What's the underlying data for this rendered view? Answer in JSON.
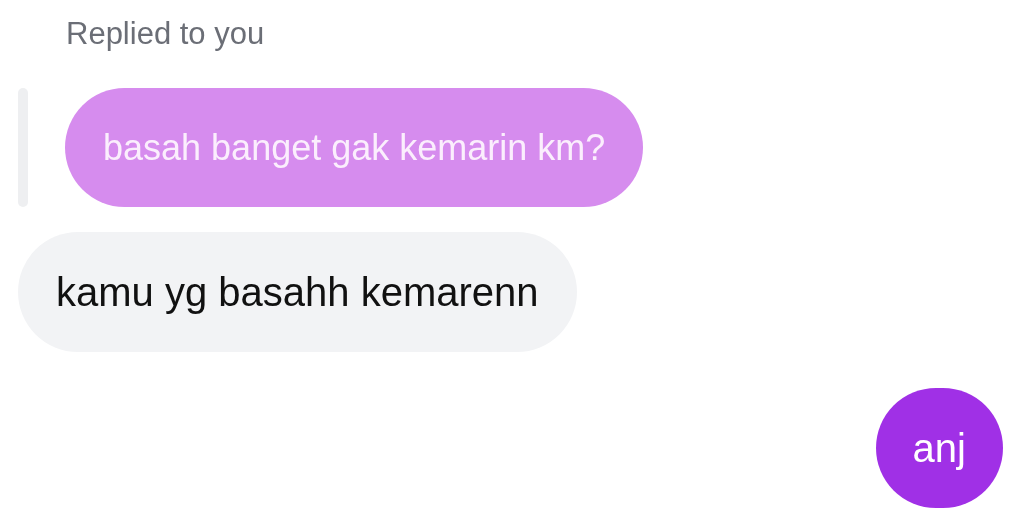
{
  "reply_label": "Replied to you",
  "quoted_message": {
    "text": "basah banget gak kemarin km?"
  },
  "messages": [
    {
      "kind": "received",
      "text": "kamu yg basahh kemarenn"
    },
    {
      "kind": "sent",
      "text": "anj"
    }
  ]
}
